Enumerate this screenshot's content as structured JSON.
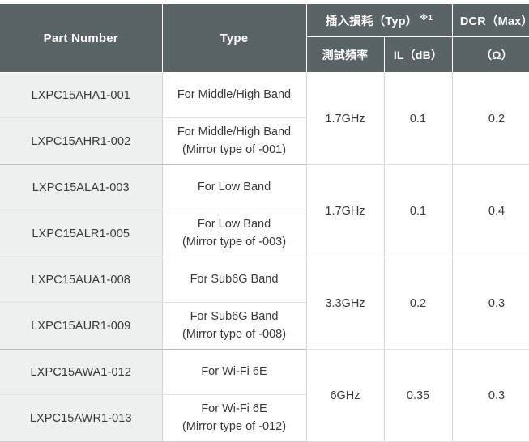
{
  "table": {
    "headers": {
      "part_number": "Part Number",
      "type": "Type",
      "insertion_loss_group": "插入損耗（Typ）",
      "insertion_loss_note": "※1",
      "test_frequency": "測試頻率",
      "il_db": "IL（dB）",
      "dcr_group": "DCR（Max）",
      "dcr_unit": "（Ω）"
    },
    "groups": [
      {
        "test_frequency": "1.7GHz",
        "il": "0.1",
        "dcr": "0.2",
        "rows": [
          {
            "part_number": "LXPC15AHA1-001",
            "type_line1": "For Middle/High Band",
            "type_line2": ""
          },
          {
            "part_number": "LXPC15AHR1-002",
            "type_line1": "For Middle/High Band",
            "type_line2": "(Mirror type of -001)"
          }
        ]
      },
      {
        "test_frequency": "1.7GHz",
        "il": "0.1",
        "dcr": "0.4",
        "rows": [
          {
            "part_number": "LXPC15ALA1-003",
            "type_line1": "For Low Band",
            "type_line2": ""
          },
          {
            "part_number": "LXPC15ALR1-005",
            "type_line1": "For Low Band",
            "type_line2": "(Mirror type of -003)"
          }
        ]
      },
      {
        "test_frequency": "3.3GHz",
        "il": "0.2",
        "dcr": "0.3",
        "rows": [
          {
            "part_number": "LXPC15AUA1-008",
            "type_line1": "For Sub6G Band",
            "type_line2": ""
          },
          {
            "part_number": "LXPC15AUR1-009",
            "type_line1": "For Sub6G Band",
            "type_line2": "(Mirror type of -008)"
          }
        ]
      },
      {
        "test_frequency": "6GHz",
        "il": "0.35",
        "dcr": "0.3",
        "rows": [
          {
            "part_number": "LXPC15AWA1-012",
            "type_line1": "For Wi-Fi 6E",
            "type_line2": ""
          },
          {
            "part_number": "LXPC15AWR1-013",
            "type_line1": "For Wi-Fi 6E",
            "type_line2": "(Mirror type of -012)"
          }
        ]
      }
    ]
  },
  "colors": {
    "header_background": "#5a6366",
    "header_text": "#ffffff",
    "part_column_background": "#eeefef",
    "body_text": "#35393c",
    "cell_border": "#d2d4d5",
    "group_border": "#b9bcbd"
  }
}
